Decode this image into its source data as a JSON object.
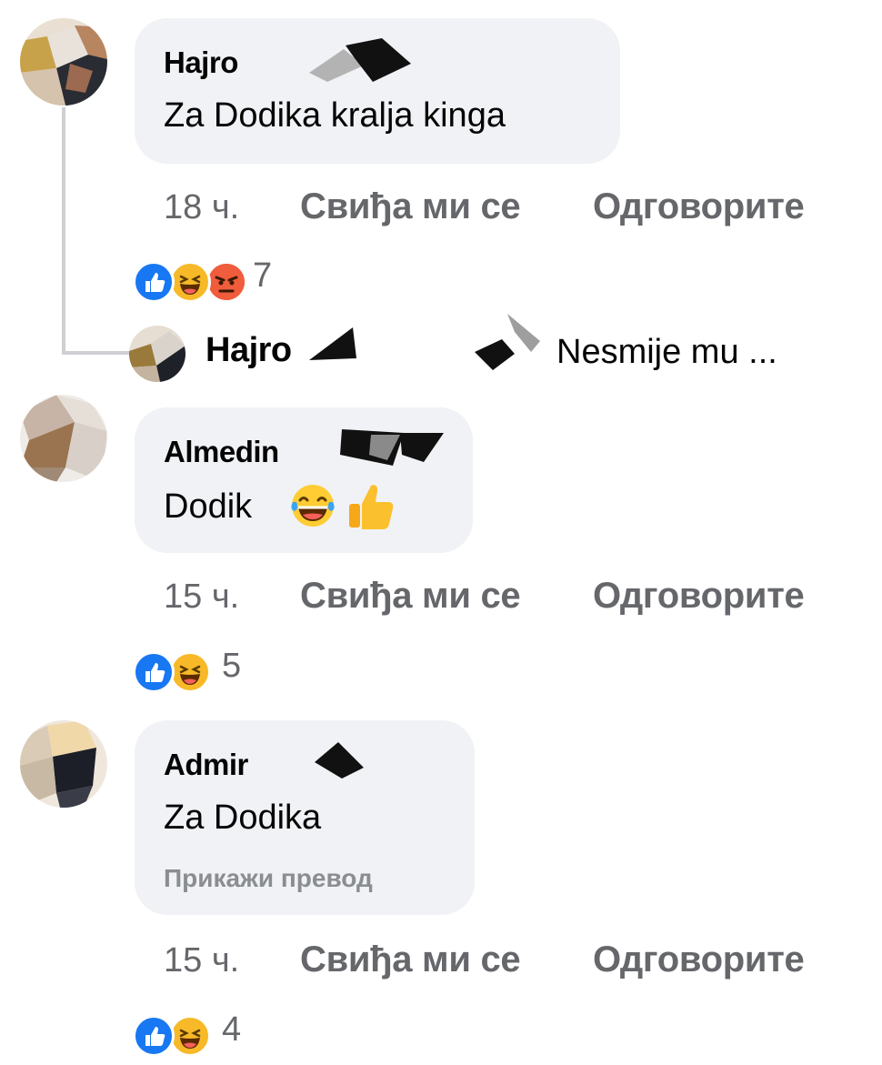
{
  "comments": [
    {
      "author": "Hajro",
      "text": "Za Dodika kralja kinga",
      "time": "18 ч.",
      "like_label": "Свиђа ми се",
      "reply_label": "Одговорите",
      "reactions": [
        "like",
        "haha",
        "angry"
      ],
      "reaction_count": "7"
    },
    {
      "author": "Almedin",
      "text": "Dodik",
      "emojis": [
        "laughing-tears",
        "thumbs-up"
      ],
      "time": "15 ч.",
      "like_label": "Свиђа ми се",
      "reply_label": "Одговорите",
      "reactions": [
        "like",
        "haha"
      ],
      "reaction_count": "5"
    },
    {
      "author": "Admir",
      "text": "Za Dodika",
      "translate_label": "Прикажи превод",
      "time": "15 ч.",
      "like_label": "Свиђа ми се",
      "reply_label": "Одговорите",
      "reactions": [
        "like",
        "haha"
      ],
      "reaction_count": "4"
    }
  ],
  "reply_preview": {
    "author": "Hajro",
    "text": "Nesmije mu ..."
  },
  "colors": {
    "bubble": "#f0f2f5",
    "meta_text": "#65676b",
    "like_blue": "#1877f2",
    "haha_yellow": "#f7b928",
    "angry_red": "#e9710f"
  }
}
